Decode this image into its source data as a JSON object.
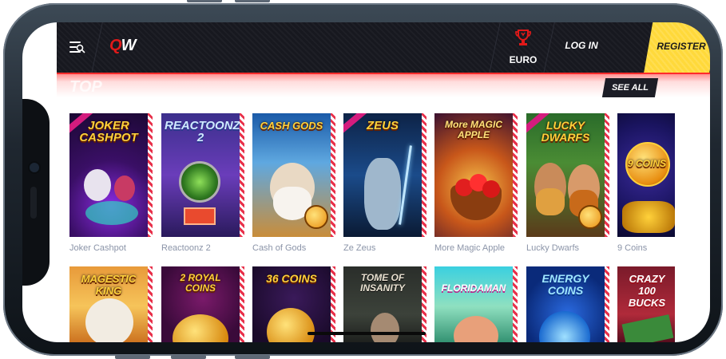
{
  "header": {
    "logo": {
      "q": "Q",
      "w": "W"
    },
    "currency_label": "EURO",
    "login_label": "LOG IN",
    "register_label": "REGISTER",
    "accent_color": "#e01919",
    "register_color": "#ffd93a"
  },
  "section": {
    "title": "TOP",
    "see_all_label": "SEE ALL"
  },
  "games_row1": [
    {
      "name": "Joker Cashpot",
      "art_title": "JOKER CASHPOT"
    },
    {
      "name": "Reactoonz 2",
      "art_title": "REACTOONZ 2"
    },
    {
      "name": "Cash of Gods",
      "art_title": "CASH GODS"
    },
    {
      "name": "Ze Zeus",
      "art_title": "ZEUS"
    },
    {
      "name": "More Magic Apple",
      "art_title": "More MAGIC APPLE"
    },
    {
      "name": "Lucky Dwarfs",
      "art_title": "LUCKY DWARFS"
    },
    {
      "name": "9 Coins",
      "art_title": "9 COINS"
    }
  ],
  "games_row2": [
    {
      "art_title": "MAGESTIC KING"
    },
    {
      "art_title": "2 ROYAL COINS"
    },
    {
      "art_title": "36 COINS"
    },
    {
      "art_title": "TOME OF INSANITY"
    },
    {
      "art_title": "FLORIDAMAN"
    },
    {
      "art_title": "ENERGY COINS"
    },
    {
      "art_title": "CRAZY 100 BUCKS"
    }
  ]
}
